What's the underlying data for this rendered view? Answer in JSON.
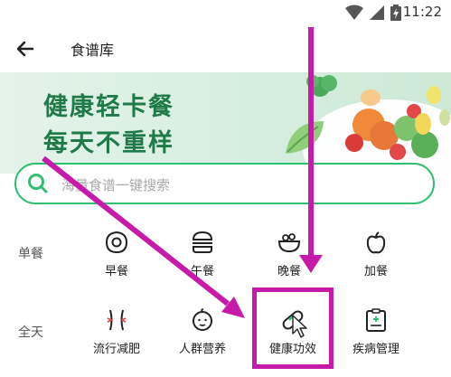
{
  "status_bar": {
    "time": "11:22"
  },
  "app_bar": {
    "title": "食谱库"
  },
  "banner": {
    "line1": "健康轻卡餐",
    "line2": "每天不重样"
  },
  "search": {
    "placeholder": "海量食谱一键搜索"
  },
  "rows": [
    {
      "label": "单餐",
      "items": [
        {
          "label": "早餐",
          "icon": "fried-egg-icon"
        },
        {
          "label": "午餐",
          "icon": "burger-icon"
        },
        {
          "label": "晚餐",
          "icon": "bowl-icon"
        },
        {
          "label": "加餐",
          "icon": "apple-icon"
        }
      ]
    },
    {
      "label": "全天",
      "items": [
        {
          "label": "流行减肥",
          "icon": "body-shape-icon"
        },
        {
          "label": "人群营养",
          "icon": "baby-face-icon"
        },
        {
          "label": "健康功效",
          "icon": "pill-icon"
        },
        {
          "label": "疾病管理",
          "icon": "medical-clipboard-icon"
        }
      ]
    }
  ],
  "colors": {
    "accent": "#2fbf71",
    "annotation": "#c71aa8",
    "banner_text": "#1f7a48"
  }
}
